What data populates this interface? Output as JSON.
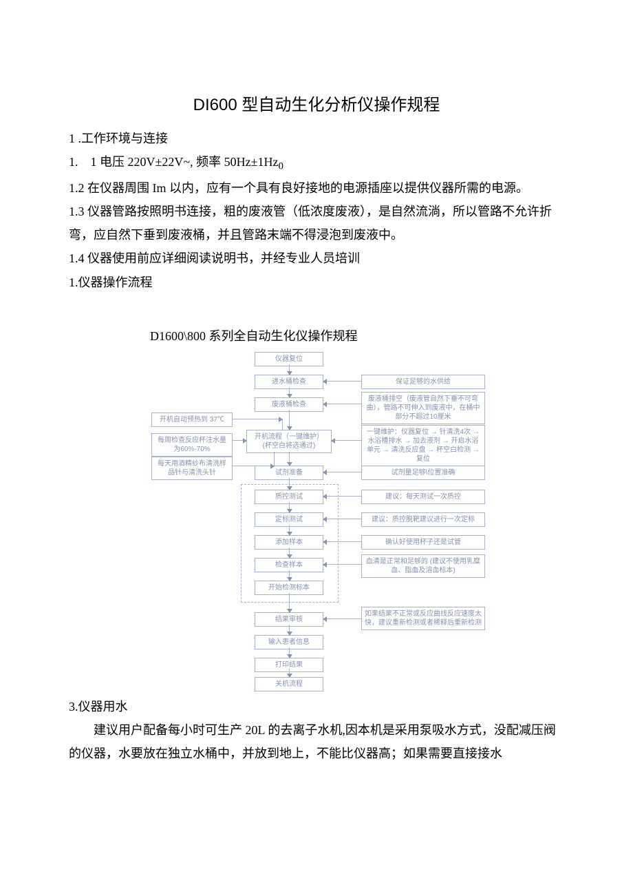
{
  "title": "DI600 型自动生化分析仪操作规程",
  "sec1": {
    "h": "1 .工作环境与连接",
    "p1a": "1.　1 电压 220V±22V~, 频率 50Hz±1Hz",
    "p1b": "0",
    "p2": "1.2 在仪器周围 Im 以内，应有一个具有良好接地的电源插座以提供仪器所需的电源。",
    "p3": "1.3 仪器管路按照明书连接，粗的废液管（低浓度废液），是自然流淌，所以管路不允许折弯，应自然下垂到废液桶，并且管路末端不得浸泡到废液中。",
    "p4": "1.4 仪器使用前应详细阅读说明书，并经专业人员培训",
    "p5": "1.仪器操作流程"
  },
  "flow": {
    "title": "D1600\\800 系列全自动生化仪操作规程",
    "center": {
      "n1": "仪器复位",
      "n2": "进水桶检查",
      "n3": "废液桶检查",
      "n4": "开机流程（一键维护）\n(杯空白将选通过)",
      "n5": "试剂准备",
      "n6": "质控测试",
      "n7": "定标测试",
      "n8": "添加样本",
      "n9": "检查样本",
      "n10": "开始检测标本",
      "n11": "结果审核",
      "n12": "输入患者信息",
      "n13": "打印结果",
      "n14": "关机流程"
    },
    "left": {
      "l1": "开机自动预热到 37℃",
      "l2": "每周检查反应杯注水量为60%-70%",
      "l3": "每天用酒精纱布清洗样品针与清洗头针"
    },
    "right": {
      "r1": "保证足够的水供给",
      "r2": "废液桶排空（废液管自然下垂不可弯曲），管路不可伸入到废液中，在桶中部分不超过10厘米",
      "r3": "一键维护：仪器复位 → 针清洗4次 → 水浴槽排水 → 加去液剂 → 开启水浴单元 → 清洗反应盘 → 杯空白检测 → 复位",
      "r4": "试剂量足够\\位置准确",
      "r5": "建议：每天测试一次质控",
      "r6": "建议：质控脱靶建议进行一次定标",
      "r7": "确认好使用杯子还是试管",
      "r8": "血清是正常和足够的 (建议不使用乳糜血、脂血及溶血标本)",
      "r9": "如果结果不正常或反应曲线反应速度太快，建议重新检测或者稀释后重新检测"
    }
  },
  "sec3": {
    "h": "3.仪器用水",
    "p1": "建议用户配备每小时可生产 20L 的去离子水机,因本机是采用泵吸水方式，没配减压阀的仪器，水要放在独立水桶中，并放到地上，不能比仪器高；如果需要直接接水"
  }
}
